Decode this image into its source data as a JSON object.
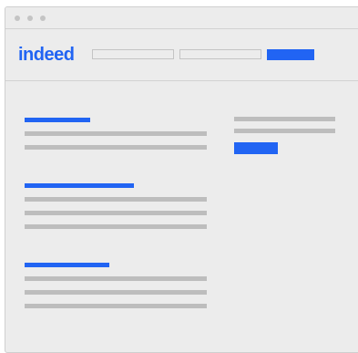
{
  "brand": {
    "logo_text": "indeed",
    "accent_color": "#2164f3"
  },
  "window": {
    "titlebar_buttons": [
      "close-dot",
      "minimize-dot",
      "zoom-dot"
    ]
  },
  "search": {
    "what_placeholder": "",
    "where_placeholder": "",
    "find_label": ""
  },
  "results": [
    {
      "title": "",
      "lines": [
        "",
        "",
        ""
      ]
    },
    {
      "title": "",
      "lines": [
        "",
        "",
        ""
      ]
    },
    {
      "title": "",
      "lines": [
        "",
        "",
        ""
      ]
    }
  ],
  "sidebar": {
    "lines": [
      "",
      ""
    ],
    "button_label": ""
  }
}
